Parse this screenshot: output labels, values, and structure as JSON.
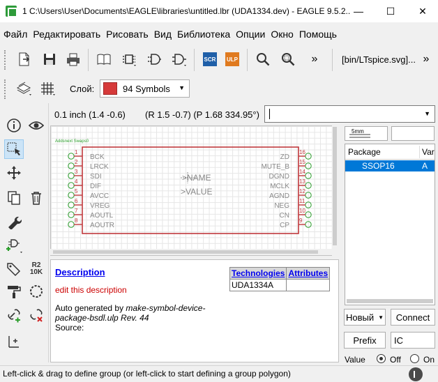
{
  "window": {
    "title": "1 C:\\Users\\User\\Documents\\EAGLE\\libraries\\untitled.lbr (UDA1334.dev) - EAGLE 9.5.2...",
    "minimize": "—",
    "maximize": "☐",
    "close": "✕"
  },
  "menu": [
    "Файл",
    "Редактировать",
    "Рисовать",
    "Вид",
    "Библиотека",
    "Опции",
    "Окно",
    "Помощь"
  ],
  "toolbar": {
    "script_label": "SCR",
    "ulp_label": "ULP",
    "more": "»",
    "more2": "»",
    "command_text": "[bin/LTspice.svg]..."
  },
  "layer": {
    "label": "Слой:",
    "value": "94 Symbols",
    "color": "#d63a3a"
  },
  "coords": {
    "grid": "0.1 inch (1.4 -0.6)",
    "polar": "(R 1.5 -0.7) (P 1.68 334.95°)"
  },
  "symbol": {
    "name": ">NAME",
    "value": ">VALUE",
    "left_pins": [
      "BCK",
      "LRCK",
      "SDI",
      "DIF",
      "AVCC",
      "VREG",
      "AOUTL",
      "AOUTR"
    ],
    "right_pins": [
      "ZD",
      "MUTE_B",
      "DGND",
      "MCLK",
      "AGND",
      "NEG",
      "CN",
      "CP"
    ],
    "left_pin_numbers": [
      "1",
      "2",
      "3",
      "4",
      "5",
      "6",
      "7",
      "8"
    ],
    "right_pin_numbers": [
      "16",
      "15",
      "14",
      "13",
      "12",
      "11",
      "10",
      "9"
    ],
    "corner_label": "Addsnext Swaps0",
    "body_color": "#c0383c"
  },
  "description": {
    "heading": "Description",
    "edit": "edit this description",
    "auto_prefix": "Auto generated by ",
    "auto_tool": "make-symbol-device-package-bsdl.ulp Rev. 44",
    "source": "Source:"
  },
  "tech_table": {
    "col1": "Technologies",
    "col2": "Attributes",
    "rows": [
      [
        "UDA1334A",
        ""
      ]
    ]
  },
  "packages": {
    "preview_label": "5mm",
    "header_package": "Package",
    "header_variant": "Var",
    "rows": [
      {
        "package": "SSOP16",
        "variant": "A"
      }
    ]
  },
  "buttons": {
    "new": "Новый",
    "connect": "Connect",
    "prefix": "Prefix",
    "prefix_value": "IC",
    "value_label": "Value",
    "off": "Off",
    "on": "On"
  },
  "status": {
    "text": "Left-click & drag to define group (or left-click to start defining a group polygon)"
  }
}
